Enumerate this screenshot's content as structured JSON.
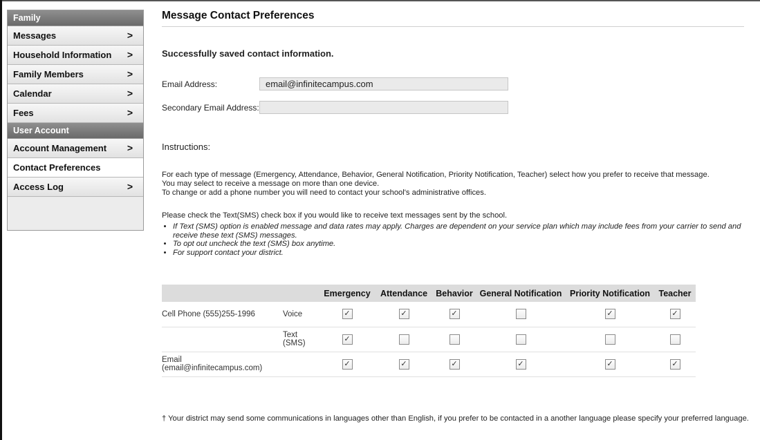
{
  "sidebar": {
    "family_header": "Family",
    "family_items": [
      {
        "label": "Messages",
        "chevron": ">"
      },
      {
        "label": "Household Information",
        "chevron": ">"
      },
      {
        "label": "Family Members",
        "chevron": ">"
      },
      {
        "label": "Calendar",
        "chevron": ">"
      },
      {
        "label": "Fees",
        "chevron": ">"
      }
    ],
    "user_header": "User Account",
    "user_items": [
      {
        "label": "Account Management",
        "chevron": ">"
      },
      {
        "label": "Contact Preferences",
        "chevron": ""
      },
      {
        "label": "Access Log",
        "chevron": ">"
      }
    ]
  },
  "main": {
    "title": "Message Contact Preferences",
    "success": "Successfully saved contact information.",
    "email_label": "Email Address:",
    "email_value": "email@infinitecampus.com",
    "secondary_email_label": "Secondary Email Address:",
    "secondary_email_value": "",
    "instructions_title": "Instructions:",
    "instructions_lines": [
      "For each type of message (Emergency, Attendance, Behavior, General Notification, Priority Notification, Teacher) select how you prefer to receive that message.",
      "You may select to receive a message on more than one device.",
      "To change or add a phone number you will need to contact your school's administrative offices."
    ],
    "sms_note": "Please check the Text(SMS) check box if you would like to receive text messages sent by the school.",
    "bullets": [
      "If Text (SMS) option is enabled message and data rates may apply. Charges are dependent on your service plan which may include fees from your carrier to send and receive these text (SMS) messages.",
      "To opt out uncheck the text (SMS) box anytime.",
      "For support contact your district."
    ],
    "footnote": "† Your district may send some communications in languages other than English, if you prefer to be contacted in a another language please specify your preferred language."
  },
  "table": {
    "columns": [
      "Emergency",
      "Attendance",
      "Behavior",
      "General Notification",
      "Priority Notification",
      "Teacher"
    ],
    "rows": [
      {
        "contact": "Cell Phone (555)255-1996",
        "method": "Voice",
        "checks": [
          true,
          true,
          true,
          false,
          true,
          true
        ]
      },
      {
        "contact": "",
        "method": "Text (SMS)",
        "checks": [
          true,
          false,
          false,
          false,
          false,
          false
        ]
      },
      {
        "contact": "Email (email@infinitecampus.com)",
        "method": "",
        "checks": [
          true,
          true,
          true,
          true,
          true,
          true
        ]
      }
    ]
  }
}
